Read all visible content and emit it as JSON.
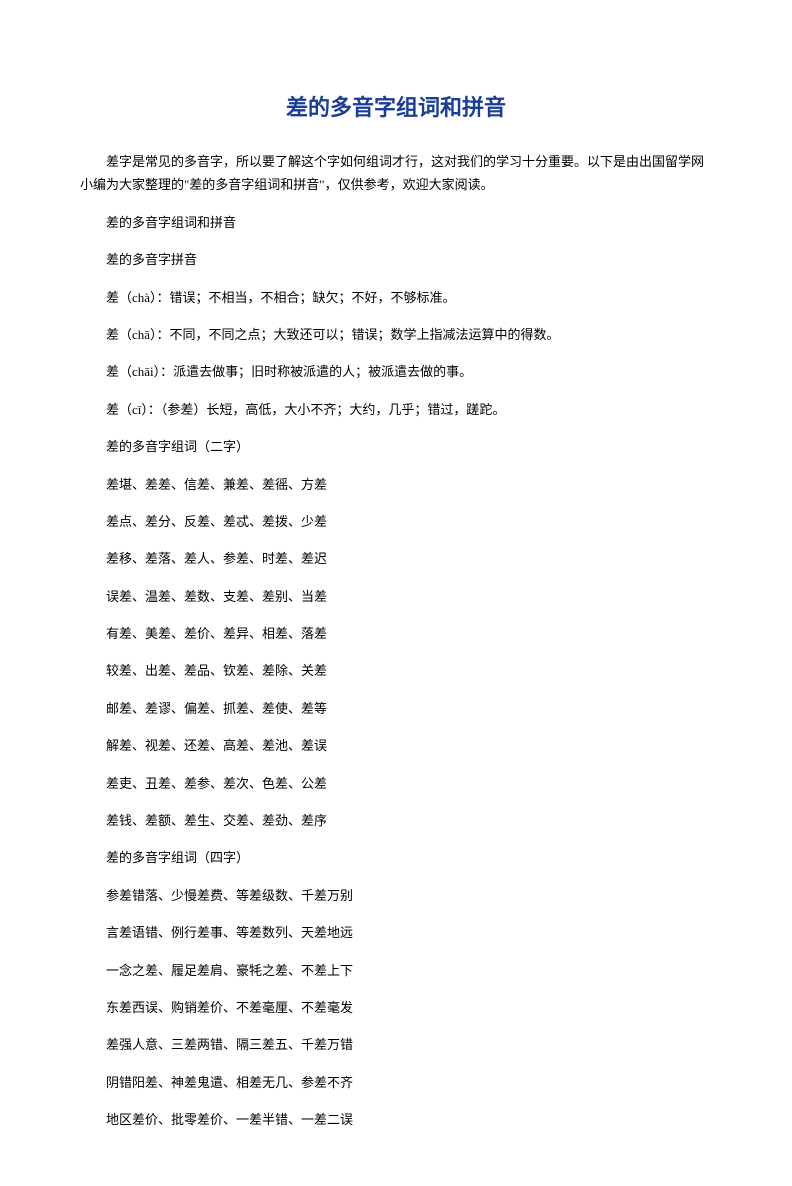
{
  "title": "差的多音字组词和拼音",
  "intro": "差字是常见的多音字，所以要了解这个字如何组词才行，这对我们的学习十分重要。以下是由出国留学网小编为大家整理的\"差的多音字组词和拼音\"，仅供参考，欢迎大家阅读。",
  "lines": [
    "差的多音字组词和拼音",
    "差的多音字拼音",
    "差（chà）：错误；不相当，不相合；缺欠；不好，不够标准。",
    "差（chā）：不同，不同之点；大致还可以；错误；数学上指减法运算中的得数。",
    "差（chāi）：派遣去做事；旧时称被派遣的人；被派遣去做的事。",
    "差（cī）：（参差）长短，高低，大小不齐；大约，几乎；错过，蹉跎。",
    "差的多音字组词（二字）",
    "差堪、差差、信差、兼差、差徭、方差",
    "差点、差分、反差、差忒、差拨、少差",
    "差移、差落、差人、参差、时差、差迟",
    "误差、温差、差数、支差、差别、当差",
    "有差、美差、差价、差异、相差、落差",
    "较差、出差、差品、钦差、差除、关差",
    "邮差、差谬、偏差、抓差、差使、差等",
    "解差、视差、还差、高差、差池、差误",
    "差吏、丑差、差参、差次、色差、公差",
    "差钱、差额、差生、交差、差劲、差序",
    "差的多音字组词（四字）",
    "参差错落、少慢差费、等差级数、千差万别",
    "言差语错、例行差事、等差数列、天差地远",
    "一念之差、履足差肩、豪牦之差、不差上下",
    "东差西误、购销差价、不差毫厘、不差毫发",
    "差强人意、三差两错、隔三差五、千差万错",
    "阴错阳差、神差鬼遣、相差无几、参差不齐",
    "地区差价、批零差价、一差半错、一差二误"
  ]
}
